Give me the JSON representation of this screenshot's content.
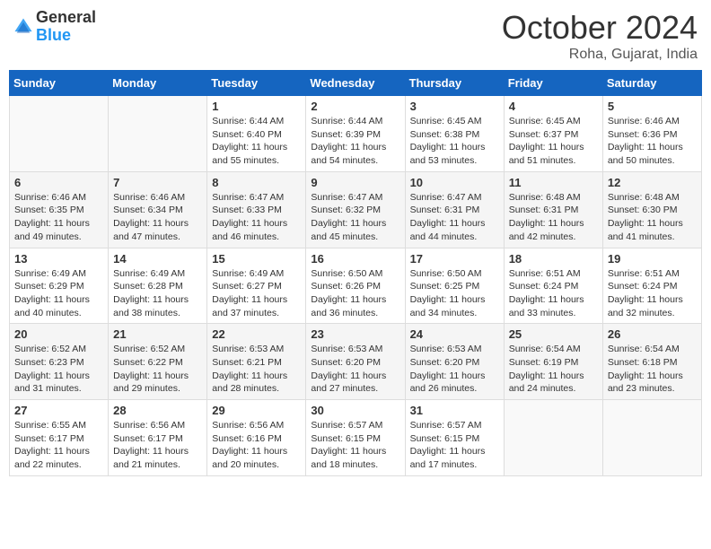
{
  "logo": {
    "general": "General",
    "blue": "Blue"
  },
  "title": "October 2024",
  "location": "Roha, Gujarat, India",
  "weekdays": [
    "Sunday",
    "Monday",
    "Tuesday",
    "Wednesday",
    "Thursday",
    "Friday",
    "Saturday"
  ],
  "weeks": [
    [
      {
        "day": "",
        "info": ""
      },
      {
        "day": "",
        "info": ""
      },
      {
        "day": "1",
        "info": "Sunrise: 6:44 AM\nSunset: 6:40 PM\nDaylight: 11 hours and 55 minutes."
      },
      {
        "day": "2",
        "info": "Sunrise: 6:44 AM\nSunset: 6:39 PM\nDaylight: 11 hours and 54 minutes."
      },
      {
        "day": "3",
        "info": "Sunrise: 6:45 AM\nSunset: 6:38 PM\nDaylight: 11 hours and 53 minutes."
      },
      {
        "day": "4",
        "info": "Sunrise: 6:45 AM\nSunset: 6:37 PM\nDaylight: 11 hours and 51 minutes."
      },
      {
        "day": "5",
        "info": "Sunrise: 6:46 AM\nSunset: 6:36 PM\nDaylight: 11 hours and 50 minutes."
      }
    ],
    [
      {
        "day": "6",
        "info": "Sunrise: 6:46 AM\nSunset: 6:35 PM\nDaylight: 11 hours and 49 minutes."
      },
      {
        "day": "7",
        "info": "Sunrise: 6:46 AM\nSunset: 6:34 PM\nDaylight: 11 hours and 47 minutes."
      },
      {
        "day": "8",
        "info": "Sunrise: 6:47 AM\nSunset: 6:33 PM\nDaylight: 11 hours and 46 minutes."
      },
      {
        "day": "9",
        "info": "Sunrise: 6:47 AM\nSunset: 6:32 PM\nDaylight: 11 hours and 45 minutes."
      },
      {
        "day": "10",
        "info": "Sunrise: 6:47 AM\nSunset: 6:31 PM\nDaylight: 11 hours and 44 minutes."
      },
      {
        "day": "11",
        "info": "Sunrise: 6:48 AM\nSunset: 6:31 PM\nDaylight: 11 hours and 42 minutes."
      },
      {
        "day": "12",
        "info": "Sunrise: 6:48 AM\nSunset: 6:30 PM\nDaylight: 11 hours and 41 minutes."
      }
    ],
    [
      {
        "day": "13",
        "info": "Sunrise: 6:49 AM\nSunset: 6:29 PM\nDaylight: 11 hours and 40 minutes."
      },
      {
        "day": "14",
        "info": "Sunrise: 6:49 AM\nSunset: 6:28 PM\nDaylight: 11 hours and 38 minutes."
      },
      {
        "day": "15",
        "info": "Sunrise: 6:49 AM\nSunset: 6:27 PM\nDaylight: 11 hours and 37 minutes."
      },
      {
        "day": "16",
        "info": "Sunrise: 6:50 AM\nSunset: 6:26 PM\nDaylight: 11 hours and 36 minutes."
      },
      {
        "day": "17",
        "info": "Sunrise: 6:50 AM\nSunset: 6:25 PM\nDaylight: 11 hours and 34 minutes."
      },
      {
        "day": "18",
        "info": "Sunrise: 6:51 AM\nSunset: 6:24 PM\nDaylight: 11 hours and 33 minutes."
      },
      {
        "day": "19",
        "info": "Sunrise: 6:51 AM\nSunset: 6:24 PM\nDaylight: 11 hours and 32 minutes."
      }
    ],
    [
      {
        "day": "20",
        "info": "Sunrise: 6:52 AM\nSunset: 6:23 PM\nDaylight: 11 hours and 31 minutes."
      },
      {
        "day": "21",
        "info": "Sunrise: 6:52 AM\nSunset: 6:22 PM\nDaylight: 11 hours and 29 minutes."
      },
      {
        "day": "22",
        "info": "Sunrise: 6:53 AM\nSunset: 6:21 PM\nDaylight: 11 hours and 28 minutes."
      },
      {
        "day": "23",
        "info": "Sunrise: 6:53 AM\nSunset: 6:20 PM\nDaylight: 11 hours and 27 minutes."
      },
      {
        "day": "24",
        "info": "Sunrise: 6:53 AM\nSunset: 6:20 PM\nDaylight: 11 hours and 26 minutes."
      },
      {
        "day": "25",
        "info": "Sunrise: 6:54 AM\nSunset: 6:19 PM\nDaylight: 11 hours and 24 minutes."
      },
      {
        "day": "26",
        "info": "Sunrise: 6:54 AM\nSunset: 6:18 PM\nDaylight: 11 hours and 23 minutes."
      }
    ],
    [
      {
        "day": "27",
        "info": "Sunrise: 6:55 AM\nSunset: 6:17 PM\nDaylight: 11 hours and 22 minutes."
      },
      {
        "day": "28",
        "info": "Sunrise: 6:56 AM\nSunset: 6:17 PM\nDaylight: 11 hours and 21 minutes."
      },
      {
        "day": "29",
        "info": "Sunrise: 6:56 AM\nSunset: 6:16 PM\nDaylight: 11 hours and 20 minutes."
      },
      {
        "day": "30",
        "info": "Sunrise: 6:57 AM\nSunset: 6:15 PM\nDaylight: 11 hours and 18 minutes."
      },
      {
        "day": "31",
        "info": "Sunrise: 6:57 AM\nSunset: 6:15 PM\nDaylight: 11 hours and 17 minutes."
      },
      {
        "day": "",
        "info": ""
      },
      {
        "day": "",
        "info": ""
      }
    ]
  ]
}
